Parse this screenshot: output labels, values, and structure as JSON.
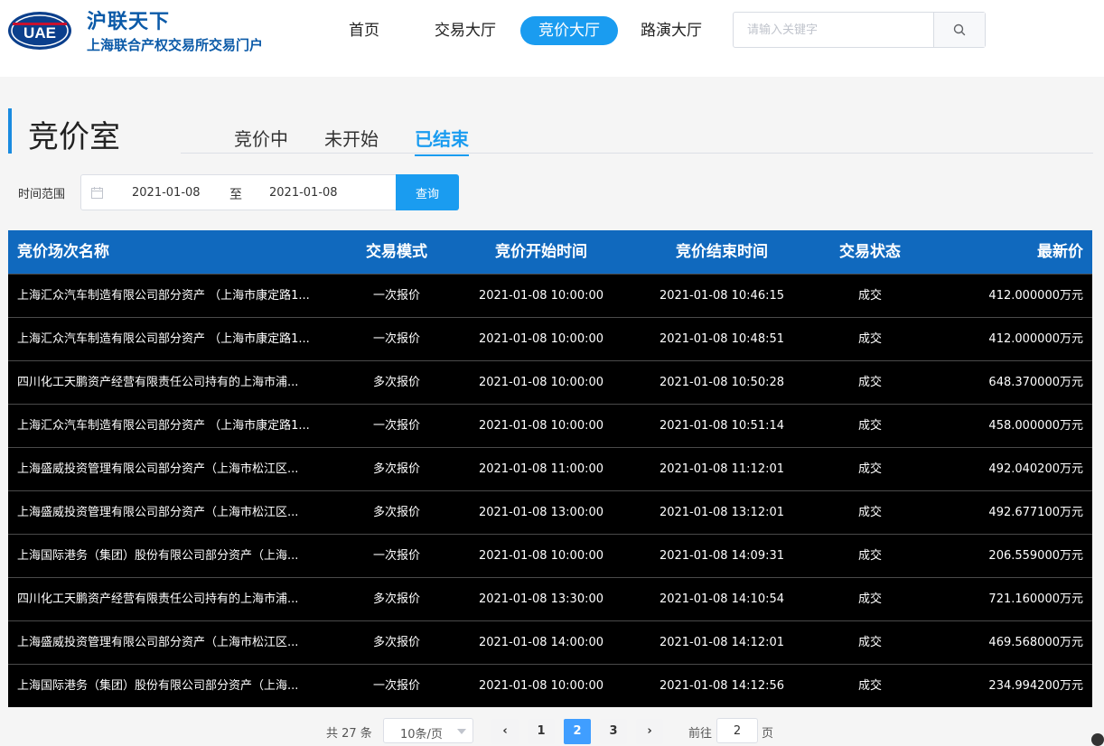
{
  "header": {
    "logo_text": "UAE",
    "brand_title": "沪联天下",
    "brand_subtitle": "上海联合产权交易所交易门户",
    "nav": [
      "首页",
      "交易大厅",
      "竞价大厅",
      "路演大厅"
    ],
    "search_placeholder": "请输入关键字",
    "colors": {
      "brand": "#0b5aa8",
      "accent": "#1a9cf0"
    }
  },
  "section": {
    "title": "竞价室",
    "tabs": [
      "竞价中",
      "未开始",
      "已结束"
    ],
    "active_tab": "已结束"
  },
  "filter": {
    "label": "时间范围",
    "start_date": "2021-01-08",
    "separator": "至",
    "end_date": "2021-01-08",
    "query_label": "查询"
  },
  "table": {
    "headers": [
      "竞价场次名称",
      "交易模式",
      "竞价开始时间",
      "竞价结束时间",
      "交易状态",
      "最新价"
    ],
    "rows": [
      {
        "name": "上海汇众汽车制造有限公司部分资产 （上海市康定路1...",
        "mode": "一次报价",
        "start": "2021-01-08 10:00:00",
        "end": "2021-01-08 10:46:15",
        "status": "成交",
        "price": "412.000000万元"
      },
      {
        "name": "上海汇众汽车制造有限公司部分资产 （上海市康定路1...",
        "mode": "一次报价",
        "start": "2021-01-08 10:00:00",
        "end": "2021-01-08 10:48:51",
        "status": "成交",
        "price": "412.000000万元"
      },
      {
        "name": "四川化工天鹏资产经营有限责任公司持有的上海市浦...",
        "mode": "多次报价",
        "start": "2021-01-08 10:00:00",
        "end": "2021-01-08 10:50:28",
        "status": "成交",
        "price": "648.370000万元"
      },
      {
        "name": "上海汇众汽车制造有限公司部分资产 （上海市康定路1...",
        "mode": "一次报价",
        "start": "2021-01-08 10:00:00",
        "end": "2021-01-08 10:51:14",
        "status": "成交",
        "price": "458.000000万元"
      },
      {
        "name": "上海盛威投资管理有限公司部分资产（上海市松江区...",
        "mode": "多次报价",
        "start": "2021-01-08 11:00:00",
        "end": "2021-01-08 11:12:01",
        "status": "成交",
        "price": "492.040200万元"
      },
      {
        "name": "上海盛威投资管理有限公司部分资产（上海市松江区...",
        "mode": "多次报价",
        "start": "2021-01-08 13:00:00",
        "end": "2021-01-08 13:12:01",
        "status": "成交",
        "price": "492.677100万元"
      },
      {
        "name": "上海国际港务（集团）股份有限公司部分资产（上海...",
        "mode": "一次报价",
        "start": "2021-01-08 10:00:00",
        "end": "2021-01-08 14:09:31",
        "status": "成交",
        "price": "206.559000万元"
      },
      {
        "name": "四川化工天鹏资产经营有限责任公司持有的上海市浦...",
        "mode": "多次报价",
        "start": "2021-01-08 13:30:00",
        "end": "2021-01-08 14:10:54",
        "status": "成交",
        "price": "721.160000万元"
      },
      {
        "name": "上海盛威投资管理有限公司部分资产（上海市松江区...",
        "mode": "多次报价",
        "start": "2021-01-08 14:00:00",
        "end": "2021-01-08 14:12:01",
        "status": "成交",
        "price": "469.568000万元"
      },
      {
        "name": "上海国际港务（集团）股份有限公司部分资产（上海...",
        "mode": "一次报价",
        "start": "2021-01-08 10:00:00",
        "end": "2021-01-08 14:12:56",
        "status": "成交",
        "price": "234.994200万元"
      }
    ]
  },
  "pagination": {
    "total_label": "共 27 条",
    "page_size": "10条/页",
    "prev_icon": "‹",
    "next_icon": "›",
    "pages": [
      "1",
      "2",
      "3"
    ],
    "current_page": "2",
    "goto_label": "前往",
    "goto_value": "2",
    "goto_suffix": "页"
  }
}
